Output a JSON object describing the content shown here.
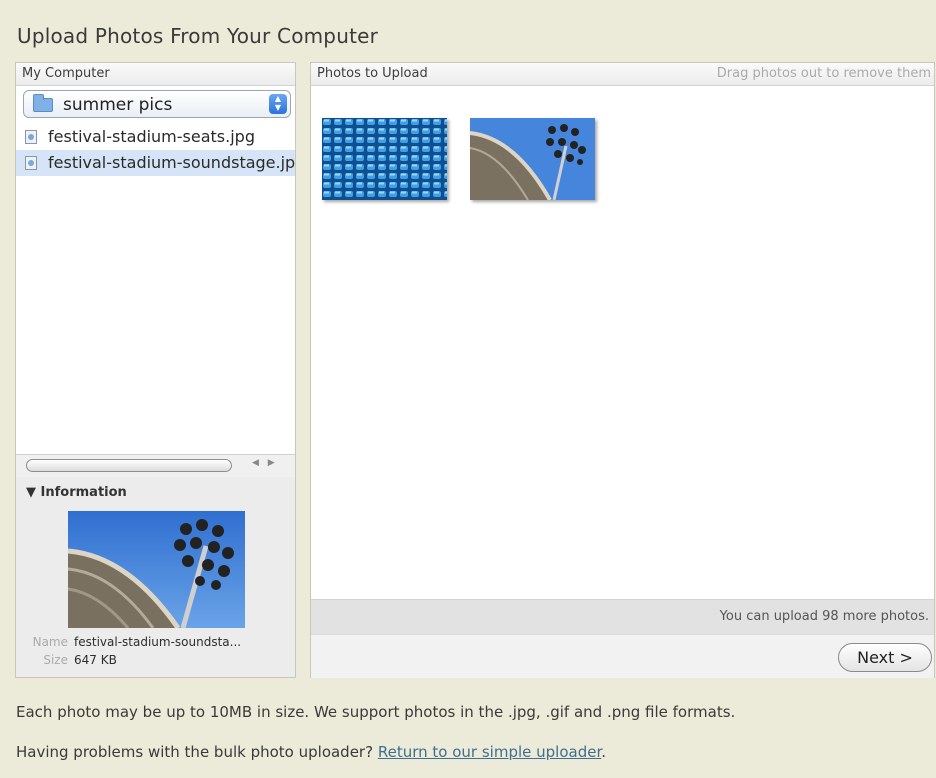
{
  "page": {
    "title": "Upload Photos From Your Computer"
  },
  "left_pane": {
    "header": "My Computer",
    "folder_select": {
      "value": "summer pics",
      "icon": "folder-icon"
    },
    "files": [
      {
        "name": "festival-stadium-seats.jpg",
        "selected": false
      },
      {
        "name": "festival-stadium-soundstage.jp",
        "selected": true
      }
    ],
    "info": {
      "title": "Information",
      "name_label": "Name",
      "name_value": "festival-stadium-soundsta...",
      "size_label": "Size",
      "size_value": "647 KB"
    }
  },
  "right_pane": {
    "header": "Photos to Upload",
    "hint": "Drag photos out to remove them",
    "status": "You can upload 98 more photos.",
    "next_label": "Next >"
  },
  "notes": {
    "size_note": "Each photo may be up to 10MB in size. We support photos in the .jpg, .gif and .png file formats.",
    "problems_text": "Having problems with the bulk photo uploader?",
    "problems_link": "Return to our simple uploader",
    "problems_end": "."
  },
  "colors": {
    "background": "#ecead8",
    "selection": "#d6e4f7",
    "sky": "#3f7fd6",
    "link": "#3f6f8f"
  }
}
